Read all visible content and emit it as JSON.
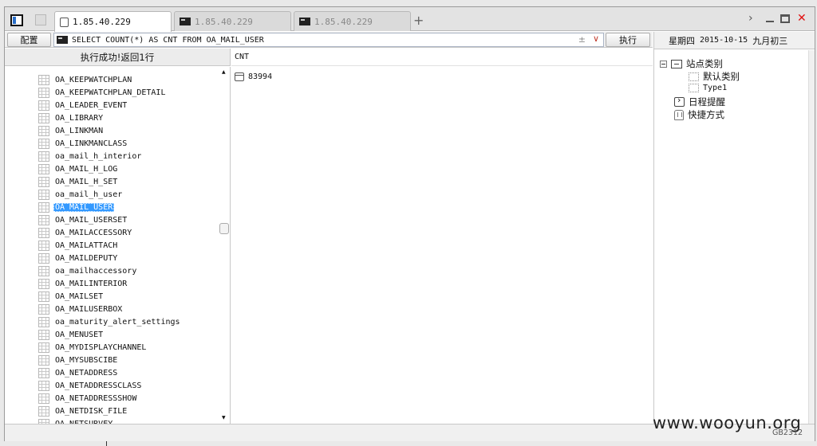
{
  "tabs": [
    {
      "label": "1.85.40.229",
      "icon": "page-icon",
      "active": true
    },
    {
      "label": "1.85.40.229",
      "icon": "terminal-icon",
      "active": false
    },
    {
      "label": "1.85.40.229",
      "icon": "terminal-icon",
      "active": false
    }
  ],
  "add_tab_label": "+",
  "window_controls": {
    "next": "›",
    "close": "✕"
  },
  "toolbar": {
    "config_label": "配置",
    "sql": "SELECT COUNT(*) AS CNT FROM OA_MAIL_USER",
    "sql_pm": "±",
    "sql_chevron": "∨",
    "execute_label": "执行"
  },
  "left_panel": {
    "status": "执行成功!返回1行",
    "selected": "OA_MAIL_USER",
    "tables": [
      "OA_KEEPWATCHPLAN",
      "OA_KEEPWATCHPLAN_DETAIL",
      "OA_LEADER_EVENT",
      "OA_LIBRARY",
      "OA_LINKMAN",
      "OA_LINKMANCLASS",
      "oa_mail_h_interior",
      "OA_MAIL_H_LOG",
      "OA_MAIL_H_SET",
      "oa_mail_h_user",
      "OA_MAIL_USER",
      "OA_MAIL_USERSET",
      "OA_MAILACCESSORY",
      "OA_MAILATTACH",
      "OA_MAILDEPUTY",
      "oa_mailhaccessory",
      "OA_MAILINTERIOR",
      "OA_MAILSET",
      "OA_MAILUSERBOX",
      "oa_maturity_alert_settings",
      "OA_MENUSET",
      "OA_MYDISPLAYCHANNEL",
      "OA_MYSUBSCIBE",
      "OA_NETADDRESS",
      "OA_NETADDRESSCLASS",
      "OA_NETADDRESSSHOW",
      "OA_NETDISK_FILE",
      "OA_NETSURVEY"
    ],
    "scroll_up": "▲",
    "scroll_down": "▼"
  },
  "result": {
    "column": "CNT",
    "value": "83994"
  },
  "right_panel": {
    "weekday": "星期四",
    "date": "2015-10-15",
    "lunar": "九月初三",
    "tree": {
      "site_category": "站点类别",
      "default_category": "默认类别",
      "type1": "Type1",
      "schedule": "日程提醒",
      "shortcuts": "快捷方式"
    }
  },
  "watermark": "www.wooyun.org",
  "encoding": "GB2312"
}
